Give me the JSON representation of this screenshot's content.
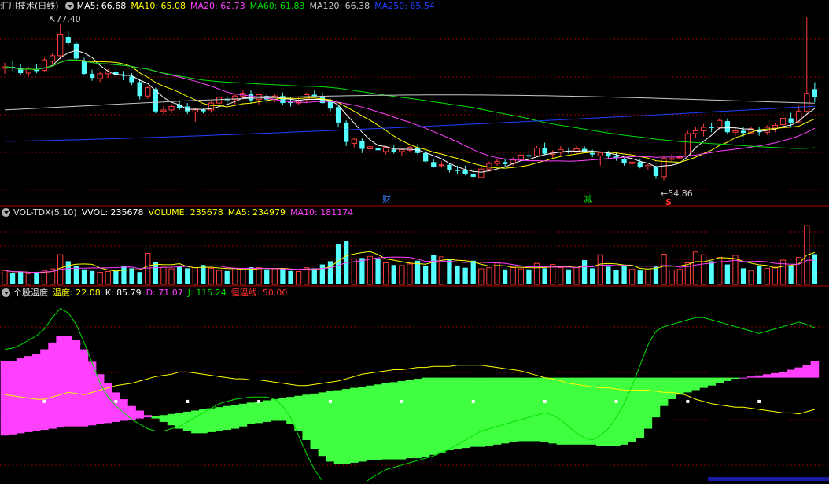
{
  "panels": {
    "main": {
      "title": "汇川技术(日线)",
      "ma_labels": [
        {
          "text": "MA5: 66.68",
          "color": "#ffffff"
        },
        {
          "text": "MA10: 65.08",
          "color": "#ffff00"
        },
        {
          "text": "MA20: 62.73",
          "color": "#ff40ff"
        },
        {
          "text": "MA60: 61.83",
          "color": "#00e000"
        },
        {
          "text": "MA120: 66.38",
          "color": "#c8c8c8"
        },
        {
          "text": "MA250: 65.54",
          "color": "#2040ff"
        }
      ],
      "high_label": "77.40",
      "low_label": "54.86",
      "events": [
        {
          "text": "财",
          "color": "#4080ff"
        },
        {
          "text": "减",
          "color": "#00e000"
        },
        {
          "text": "S",
          "color": "#ff3030"
        }
      ]
    },
    "volume": {
      "title": "VOL-TDX(5,10)",
      "labels": [
        {
          "text": "VVOL: 235678",
          "color": "#ffffff"
        },
        {
          "text": "VOLUME: 235678",
          "color": "#ffff00"
        },
        {
          "text": "MA5: 234979",
          "color": "#ffff00"
        },
        {
          "text": "MA10: 181174",
          "color": "#ff40ff"
        }
      ]
    },
    "temp": {
      "title": "个股温度",
      "labels": [
        {
          "text": "温度: 22.08",
          "color": "#ffff00"
        },
        {
          "text": "K: 85.79",
          "color": "#ffffff"
        },
        {
          "text": "D: 71.07",
          "color": "#ff40ff"
        },
        {
          "text": "J: 115.24",
          "color": "#00e000"
        },
        {
          "text": "恒温线: 50.00",
          "color": "#ff3030"
        }
      ]
    }
  },
  "colors": {
    "up": "#ff3c3c",
    "down": "#54ffff",
    "ma5": "#ffffff",
    "ma10": "#ffff00",
    "ma20": "#ff40ff",
    "ma60": "#00e000",
    "ma120": "#c8c8c8",
    "ma250": "#2040ff",
    "grid": "#8b0000",
    "separator": "#b00000",
    "bar_pos": "#ff40ff",
    "bar_neg": "#40ff40"
  },
  "chart_data": [
    {
      "type": "candlestick",
      "ylim": [
        52,
        79
      ],
      "candles": [
        [
          71.0,
          71.8,
          70.2,
          71.2
        ],
        [
          71.2,
          72.0,
          70.6,
          71.0
        ],
        [
          71.0,
          71.6,
          70.0,
          70.3
        ],
        [
          70.3,
          71.2,
          69.8,
          71.0
        ],
        [
          70.8,
          71.6,
          70.3,
          70.6
        ],
        [
          70.7,
          72.5,
          70.5,
          72.2
        ],
        [
          72.0,
          73.2,
          71.5,
          72.8
        ],
        [
          72.8,
          77.4,
          72.3,
          75.9
        ],
        [
          75.5,
          76.3,
          74.2,
          74.6
        ],
        [
          74.5,
          74.8,
          72.0,
          72.4
        ],
        [
          72.0,
          72.5,
          70.0,
          70.2
        ],
        [
          70.2,
          70.8,
          69.2,
          69.6
        ],
        [
          69.5,
          70.5,
          69.0,
          70.2
        ],
        [
          70.2,
          70.9,
          69.6,
          70.5
        ],
        [
          70.5,
          71.0,
          69.8,
          70.0
        ],
        [
          70.0,
          70.6,
          69.3,
          69.9
        ],
        [
          69.8,
          70.3,
          68.6,
          69.0
        ],
        [
          69.0,
          69.4,
          66.5,
          67.0
        ],
        [
          67.0,
          68.5,
          66.6,
          68.2
        ],
        [
          68.0,
          68.2,
          64.5,
          64.8
        ],
        [
          64.8,
          65.6,
          64.4,
          65.0
        ],
        [
          65.0,
          65.8,
          64.5,
          65.5
        ],
        [
          65.8,
          66.4,
          65.0,
          65.3
        ],
        [
          65.5,
          66.0,
          64.4,
          64.8
        ],
        [
          64.7,
          65.2,
          63.3,
          65.0
        ],
        [
          65.0,
          65.3,
          64.5,
          64.8
        ],
        [
          65.0,
          66.2,
          64.6,
          66.0
        ],
        [
          66.0,
          67.2,
          65.7,
          66.8
        ],
        [
          66.6,
          67.0,
          65.8,
          66.4
        ],
        [
          66.5,
          67.3,
          65.8,
          67.0
        ],
        [
          67.0,
          67.8,
          66.5,
          67.4
        ],
        [
          67.3,
          67.8,
          66.0,
          66.4
        ],
        [
          66.5,
          67.4,
          65.8,
          67.2
        ],
        [
          67.0,
          67.3,
          66.0,
          66.5
        ],
        [
          66.5,
          67.3,
          66.1,
          67.0
        ],
        [
          67.0,
          67.5,
          65.7,
          66.0
        ],
        [
          66.2,
          66.8,
          65.5,
          66.0
        ],
        [
          66.0,
          66.8,
          65.7,
          66.4
        ],
        [
          66.5,
          67.5,
          66.0,
          67.2
        ],
        [
          67.2,
          67.8,
          66.8,
          67.0
        ],
        [
          67.0,
          67.5,
          65.9,
          66.0
        ],
        [
          66.2,
          66.6,
          64.8,
          65.2
        ],
        [
          65.4,
          65.6,
          62.6,
          63.2
        ],
        [
          63.2,
          63.5,
          59.8,
          60.4
        ],
        [
          60.2,
          61.0,
          59.6,
          60.8
        ],
        [
          60.5,
          60.9,
          58.8,
          59.4
        ],
        [
          59.4,
          60.2,
          58.7,
          59.7
        ],
        [
          59.5,
          60.4,
          59.0,
          59.2
        ],
        [
          59.0,
          59.8,
          58.6,
          59.6
        ],
        [
          59.3,
          59.9,
          58.7,
          59.0
        ],
        [
          59.0,
          59.4,
          58.4,
          59.3
        ],
        [
          59.2,
          59.8,
          59.0,
          59.6
        ],
        [
          59.6,
          60.1,
          58.6,
          58.8
        ],
        [
          58.8,
          59.2,
          57.3,
          57.6
        ],
        [
          57.5,
          58.0,
          56.7,
          56.8
        ],
        [
          57.0,
          57.6,
          56.7,
          57.1
        ],
        [
          57.1,
          57.4,
          56.0,
          56.3
        ],
        [
          56.4,
          57.0,
          55.8,
          56.2
        ],
        [
          56.4,
          57.0,
          55.6,
          55.8
        ],
        [
          55.8,
          56.4,
          55.2,
          55.4
        ],
        [
          55.3,
          56.8,
          55.3,
          56.5
        ],
        [
          56.5,
          57.6,
          56.1,
          57.3
        ],
        [
          57.3,
          58.0,
          57.0,
          57.6
        ],
        [
          57.5,
          58.0,
          56.9,
          57.2
        ],
        [
          57.3,
          58.2,
          57.0,
          57.8
        ],
        [
          57.8,
          58.8,
          57.6,
          58.5
        ],
        [
          58.5,
          59.2,
          58.0,
          58.3
        ],
        [
          58.4,
          59.8,
          58.2,
          59.5
        ],
        [
          59.5,
          60.3,
          58.5,
          58.7
        ],
        [
          58.6,
          59.2,
          58.1,
          58.9
        ],
        [
          58.9,
          59.8,
          58.4,
          59.3
        ],
        [
          59.1,
          59.6,
          58.7,
          59.0
        ],
        [
          59.0,
          59.8,
          58.7,
          59.4
        ],
        [
          59.4,
          59.8,
          58.8,
          59.0
        ],
        [
          58.8,
          59.3,
          58.2,
          58.6
        ],
        [
          58.4,
          59.0,
          57.0,
          58.8
        ],
        [
          58.8,
          59.1,
          58.0,
          58.3
        ],
        [
          58.3,
          58.9,
          57.7,
          58.1
        ],
        [
          57.9,
          58.1,
          57.0,
          57.3
        ],
        [
          57.3,
          57.6,
          56.8,
          57.5
        ],
        [
          57.5,
          58.0,
          56.6,
          56.8
        ],
        [
          56.8,
          57.2,
          56.4,
          57.0
        ],
        [
          56.8,
          57.0,
          55.1,
          55.5
        ],
        [
          55.4,
          58.3,
          54.86,
          58.0
        ],
        [
          58.0,
          58.7,
          57.6,
          58.0
        ],
        [
          58.1,
          58.6,
          57.8,
          58.3
        ],
        [
          58.4,
          62.0,
          58.2,
          61.6
        ],
        [
          61.6,
          62.5,
          61.0,
          62.0
        ],
        [
          62.0,
          63.0,
          61.2,
          62.5
        ],
        [
          62.5,
          63.1,
          61.8,
          62.4
        ],
        [
          62.5,
          63.8,
          62.2,
          63.5
        ],
        [
          63.4,
          63.8,
          61.5,
          61.8
        ],
        [
          61.8,
          62.4,
          61.3,
          62.0
        ],
        [
          62.0,
          62.5,
          61.2,
          61.7
        ],
        [
          61.7,
          62.6,
          61.5,
          62.3
        ],
        [
          62.2,
          62.6,
          61.3,
          61.8
        ],
        [
          61.8,
          62.8,
          61.4,
          62.5
        ],
        [
          62.4,
          63.1,
          61.8,
          62.8
        ],
        [
          62.9,
          64.0,
          62.6,
          63.8
        ],
        [
          63.8,
          64.6,
          62.6,
          63.2
        ],
        [
          63.3,
          65.6,
          63.1,
          64.8
        ],
        [
          64.8,
          78.3,
          64.6,
          67.4
        ],
        [
          68.0,
          69.0,
          66.1,
          66.9
        ]
      ],
      "ma5_end": 66.68,
      "ma10_end": 65.08,
      "ma20_end": 62.73,
      "ma60_end": 61.83,
      "ma120_end": 66.38,
      "ma250_end": 65.54
    },
    {
      "type": "bar",
      "series_name": "VOLUME",
      "values": [
        52000,
        42000,
        48000,
        40000,
        44000,
        52000,
        58000,
        110000,
        86000,
        70000,
        56000,
        50000,
        45000,
        48000,
        50000,
        70000,
        60000,
        46000,
        115000,
        82000,
        64000,
        58000,
        66000,
        60000,
        62000,
        72000,
        60000,
        52000,
        50000,
        60000,
        56000,
        64000,
        62000,
        56000,
        58000,
        60000,
        50000,
        48000,
        62000,
        60000,
        74000,
        86000,
        150000,
        160000,
        95000,
        98000,
        104000,
        96000,
        80000,
        72000,
        70000,
        76000,
        88000,
        70000,
        110000,
        102000,
        95000,
        70000,
        62000,
        88000,
        58000,
        62000,
        80000,
        56000,
        62000,
        58000,
        56000,
        78000,
        60000,
        74000,
        62000,
        56000,
        62000,
        90000,
        60000,
        110000,
        66000,
        54000,
        70000,
        56000,
        52000,
        54000,
        66000,
        112000,
        54000,
        56000,
        80000,
        120000,
        110000,
        86000,
        100000,
        74000,
        108000,
        60000,
        52000,
        70000,
        60000,
        64000,
        90000,
        70000,
        100000,
        218000,
        112000
      ],
      "ma5_end": 234979,
      "ma10_end": 181174,
      "ylim": [
        0,
        235678
      ]
    },
    {
      "type": "line",
      "ylim": [
        -20,
        140
      ],
      "series": [
        {
          "name": "温度",
          "values": [
            56,
            55,
            54,
            53,
            52,
            52,
            54,
            56,
            58,
            57,
            56,
            58,
            60,
            62,
            64,
            65,
            66,
            68,
            70,
            72,
            73,
            74,
            76,
            76,
            75,
            74,
            73,
            72,
            71,
            70,
            70,
            69,
            69,
            68,
            67,
            66,
            65,
            64,
            64,
            65,
            66,
            67,
            68,
            70,
            72,
            74,
            75,
            76,
            77,
            78,
            78,
            79,
            80,
            80,
            81,
            81,
            81,
            82,
            82,
            82,
            82,
            81,
            80,
            79,
            78,
            77,
            75,
            73,
            71,
            70,
            68,
            66,
            65,
            64,
            63,
            62,
            62,
            61,
            60,
            60,
            60,
            60,
            59,
            58,
            58,
            57,
            55,
            52,
            50,
            48,
            47,
            46,
            45,
            45,
            44,
            43,
            42,
            41,
            40,
            40,
            39,
            41,
            43
          ]
        },
        {
          "name": "K",
          "values": [
            86,
            86,
            88,
            90,
            92,
            96,
            102,
            108,
            108,
            104,
            96,
            85,
            74,
            66,
            58,
            52,
            46,
            42,
            38,
            35,
            32,
            29,
            26,
            24,
            22,
            22,
            23,
            24,
            25,
            26,
            28,
            30,
            31,
            32,
            33,
            33,
            30,
            24,
            16,
            8,
            2,
            -3,
            -5,
            -5,
            -4,
            -3,
            -2,
            -2,
            -1,
            -1,
            -1,
            0,
            0,
            1,
            3,
            5,
            7,
            8,
            9,
            10,
            10,
            11,
            12,
            13,
            14,
            15,
            15,
            15,
            14,
            13,
            12,
            12,
            12,
            12,
            12,
            11,
            11,
            11,
            12,
            14,
            18,
            26,
            36,
            46,
            52,
            56,
            58,
            60,
            62,
            64,
            66,
            68,
            70,
            71,
            72,
            73,
            74,
            75,
            76,
            78,
            80,
            82,
            86
          ]
        },
        {
          "name": "D",
          "values": [
            20,
            21,
            22,
            23,
            24,
            25,
            26,
            27,
            28,
            28,
            28,
            29,
            30,
            31,
            32,
            33,
            34,
            35,
            36,
            37,
            38,
            39,
            40,
            41,
            42,
            43,
            44,
            45,
            46,
            47,
            48,
            49,
            50,
            51,
            52,
            53,
            54,
            55,
            56,
            57,
            58,
            59,
            60,
            61,
            62,
            63,
            64,
            65,
            66,
            67,
            68,
            69,
            70,
            71,
            71,
            71,
            71,
            71,
            71,
            71,
            71,
            71,
            71,
            71,
            71,
            71,
            71,
            71,
            71,
            71,
            71,
            71,
            71,
            71,
            71,
            71,
            71,
            71,
            71,
            71,
            71,
            71,
            71,
            71,
            71,
            71,
            71,
            71,
            71,
            71,
            71,
            71,
            71,
            71,
            71,
            71,
            71,
            71,
            71,
            71,
            71,
            71,
            71
          ]
        },
        {
          "name": "J",
          "values": [
            96,
            97,
            100,
            104,
            108,
            114,
            124,
            132,
            128,
            118,
            102,
            84,
            66,
            54,
            46,
            40,
            34,
            30,
            26,
            24,
            24,
            26,
            28,
            32,
            36,
            40,
            44,
            48,
            50,
            52,
            53,
            54,
            54,
            54,
            52,
            46,
            36,
            20,
            4,
            -10,
            -20,
            -28,
            -32,
            -34,
            -30,
            -24,
            -18,
            -14,
            -10,
            -8,
            -6,
            -4,
            -2,
            0,
            2,
            5,
            8,
            12,
            16,
            20,
            24,
            26,
            28,
            30,
            32,
            34,
            36,
            38,
            40,
            38,
            34,
            28,
            22,
            18,
            16,
            20,
            26,
            36,
            48,
            64,
            82,
            100,
            112,
            116,
            118,
            120,
            122,
            124,
            124,
            122,
            120,
            118,
            116,
            114,
            112,
            110,
            112,
            114,
            116,
            118,
            120,
            118,
            115
          ]
        }
      ],
      "constant_line": {
        "name": "恒温线",
        "value": 50
      }
    }
  ]
}
